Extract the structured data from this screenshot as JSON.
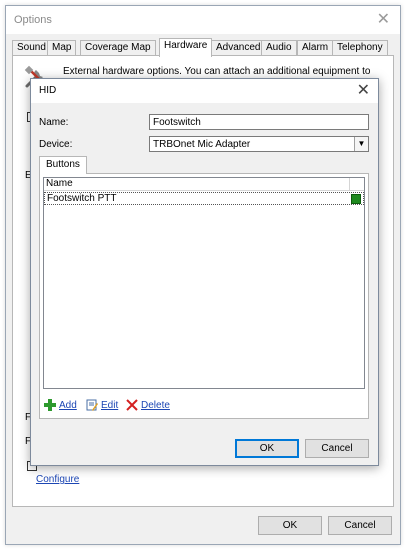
{
  "options": {
    "title": "Options",
    "tabs": [
      "Sound",
      "Map",
      "Coverage Map",
      "Hardware",
      "Advanced",
      "Audio",
      "Alarm",
      "Telephony"
    ],
    "active_tab": "Hardware",
    "hardware_description": "External hardware options. You can attach an additional equipment to control PTT button (footswitch, hand microphone, etc.)",
    "bg_fragments": [
      "Ex",
      "Fi",
      "Fi"
    ],
    "configure_link": "Configure",
    "ok_label": "OK",
    "cancel_label": "Cancel"
  },
  "hid": {
    "title": "HID",
    "name_label": "Name:",
    "name_value": "Footswitch",
    "device_label": "Device:",
    "device_value": "TRBOnet Mic Adapter",
    "buttons_tab": "Buttons",
    "list": {
      "column_name": "Name",
      "rows": [
        {
          "name": "Footswitch PTT",
          "indicator_color": "#1f8a1f"
        }
      ]
    },
    "add_label": "Add",
    "edit_label": "Edit",
    "delete_label": "Delete",
    "ok_label": "OK",
    "cancel_label": "Cancel"
  },
  "icons": {
    "close": "close-icon",
    "dropdown": "chevron-down-icon",
    "hardware": "tools-icon",
    "add": "plus-icon",
    "edit": "edit-icon",
    "delete": "delete-icon"
  },
  "colors": {
    "accent": "#0078d7",
    "link": "#1c46b4",
    "indicator": "#1f8a1f"
  }
}
